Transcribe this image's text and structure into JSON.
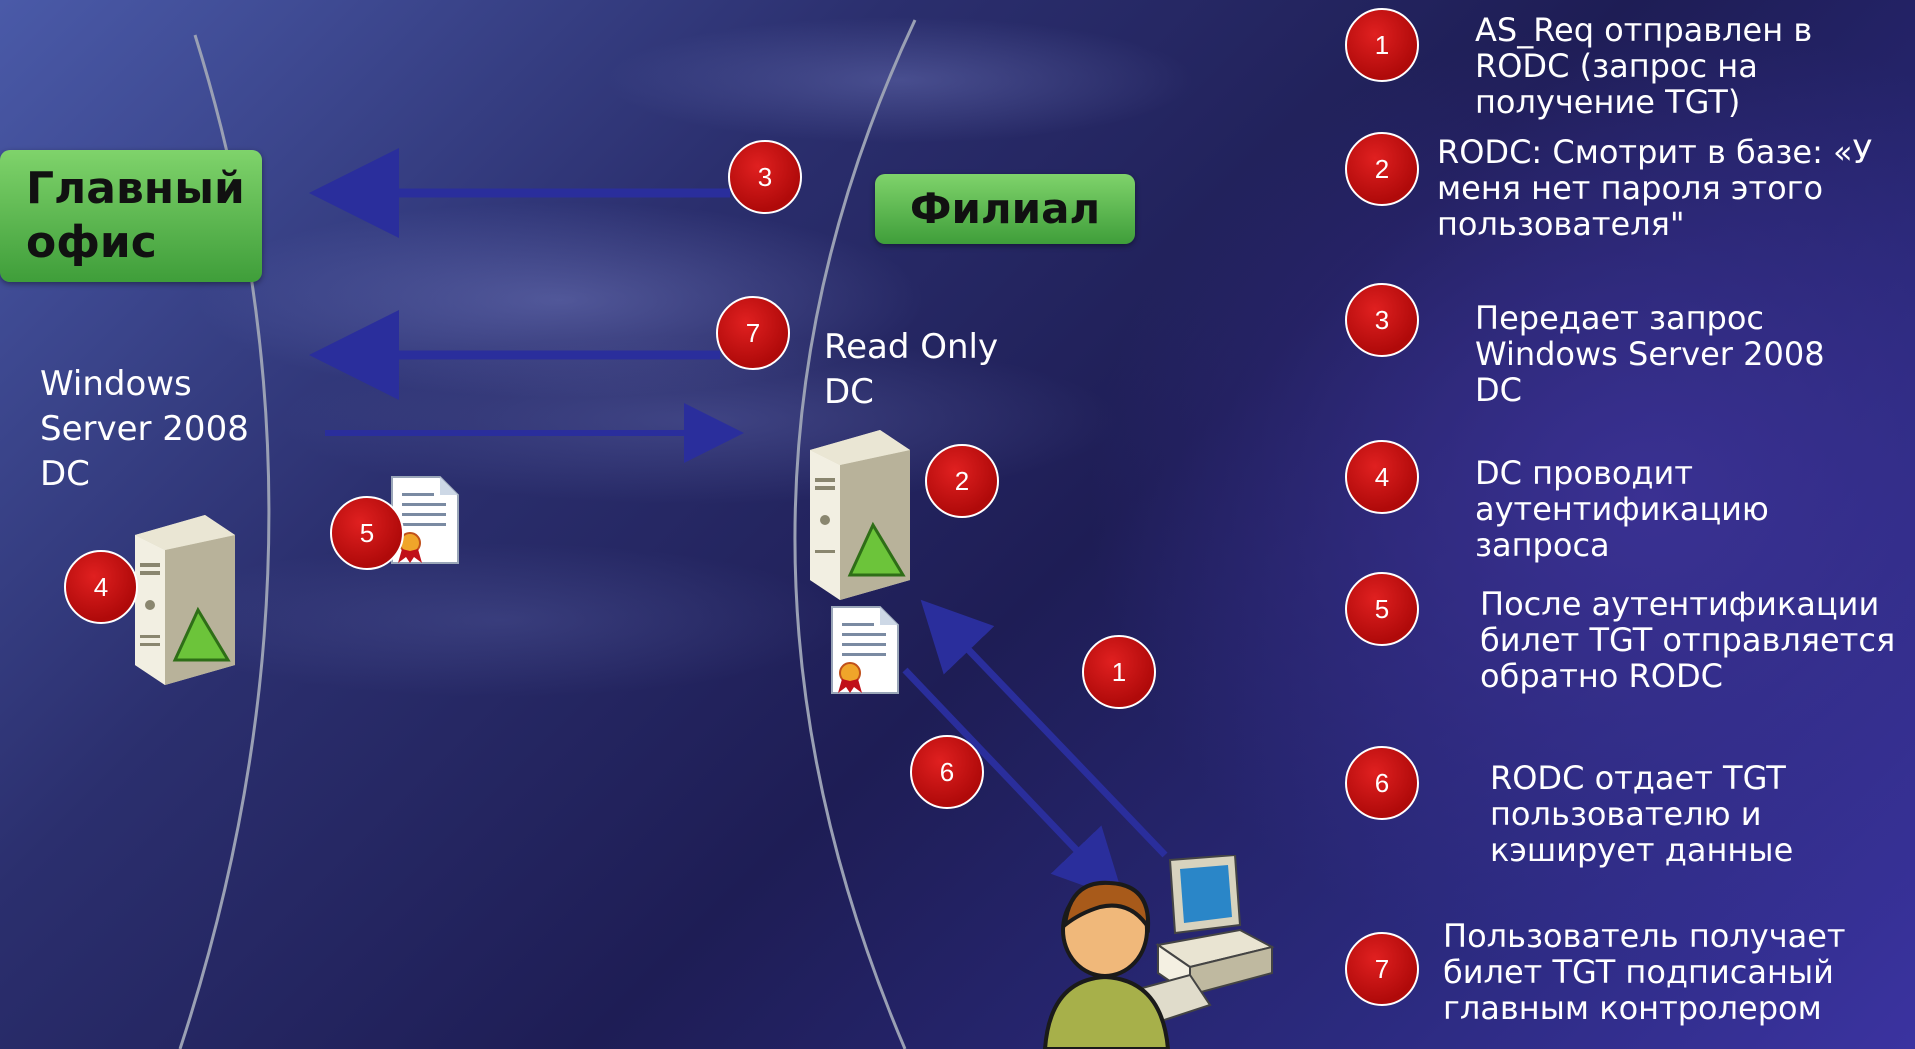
{
  "labels": {
    "main_office": "Главный\nофис",
    "branch": "Филиал",
    "main_server": "Windows\nServer 2008\nDC",
    "branch_server": "Read Only\nDC"
  },
  "diagram_badges": {
    "b3": "3",
    "b7": "7",
    "b2": "2",
    "b4": "4",
    "b5": "5",
    "b1": "1",
    "b6": "6"
  },
  "steps": [
    {
      "num": "1",
      "text": "AS_Req отправлен в\nRODC (запрос на\nполучение TGT)"
    },
    {
      "num": "2",
      "text": "RODC: Смотрит в базе: «У\nменя нет пароля этого\nпользователя\""
    },
    {
      "num": "3",
      "text": "Передает запрос\nWindows Server 2008\nDC"
    },
    {
      "num": "4",
      "text": "DC проводит\nаутентификацию\nзапроса"
    },
    {
      "num": "5",
      "text": "После аутентификации\nбилет TGT отправляется\nобратно RODC"
    },
    {
      "num": "6",
      "text": "RODC отдает TGT\nпользователю и\nкэширует данные"
    },
    {
      "num": "7",
      "text": "Пользователь получает\n    билет TGT подписаный\n    главным контролером"
    }
  ],
  "colors": {
    "arrow": "#2b2f9a",
    "badge": "#c0101a",
    "label_green": "#5bb64a"
  }
}
